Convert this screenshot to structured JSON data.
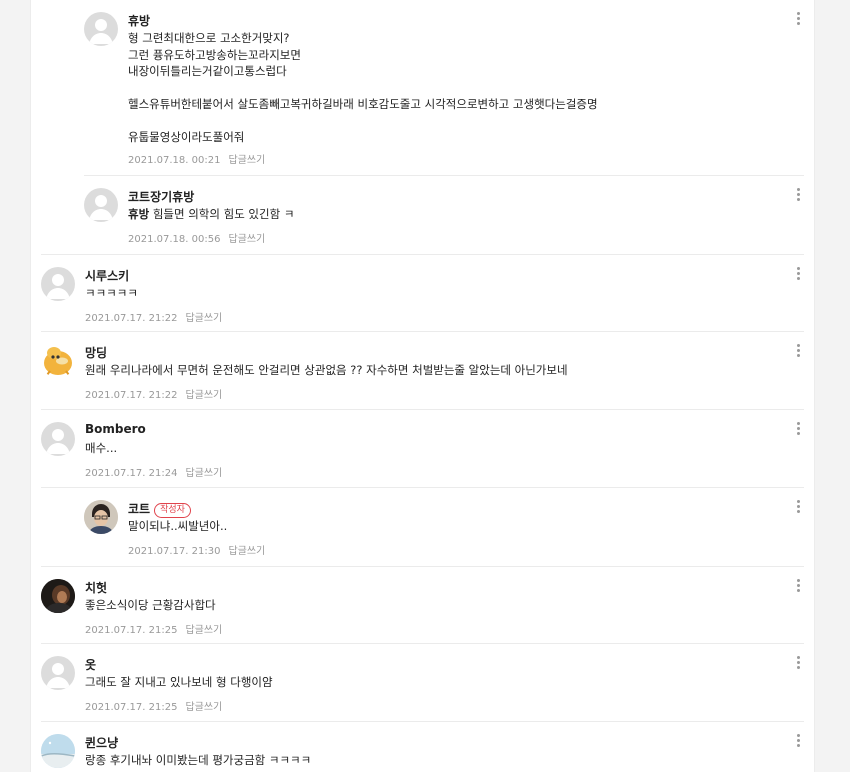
{
  "comments": [
    {
      "name": "휴방",
      "avatar": "default-avatar",
      "lines": [
        "형 그련최대한으로 고소한거맞지?",
        "그런 퓽유도하고방송하는꼬라지보면",
        "내장이뒤틀리는거같이고통스럽다",
        "",
        "헬스유튜버한테붙어서 살도좀빼고복귀하길바래 비호감도줄고 시각적으로변하고 고생햇다는걸증명",
        "",
        "유툽물영상이라도풀어줘"
      ],
      "date": "2021.07.18. 00:21",
      "reply": "답글쓰기"
    },
    {
      "name": "코트장기휴방",
      "avatar": "default-avatar",
      "mention": "휴방",
      "text": " 힘들면 의학의 힘도 있긴함 ㅋ",
      "date": "2021.07.18. 00:56",
      "reply": "답글쓰기"
    },
    {
      "name": "시루스키",
      "avatar": "default-avatar",
      "text": "ㅋㅋㅋㅋㅋ",
      "date": "2021.07.17. 21:22",
      "reply": "답글쓰기"
    },
    {
      "name": "망딩",
      "avatar": "duck-avatar",
      "text": "원래 우리나라에서 무면허 운전해도 안걸리면 상관없음 ?? 자수하면 처벌받는줄 알았는데 아닌가보네",
      "date": "2021.07.17. 21:22",
      "reply": "답글쓰기"
    },
    {
      "name": "Bombero",
      "avatar": "default-avatar",
      "text": "매수...",
      "date": "2021.07.17. 21:24",
      "reply": "답글쓰기"
    },
    {
      "name": "코트",
      "avatar": "person-photo-avatar",
      "badge": "작성자",
      "text": "말이되냐..씨발년아..",
      "date": "2021.07.17. 21:30",
      "reply": "답글쓰기"
    },
    {
      "name": "치헛",
      "avatar": "dark-photo-avatar",
      "text": "좋은소식이당 근황감사합다",
      "date": "2021.07.17. 21:25",
      "reply": "답글쓰기"
    },
    {
      "name": "옷",
      "avatar": "default-avatar",
      "text": "그래도 잘 지내고 있나보네 형 다행이얌",
      "date": "2021.07.17. 21:25",
      "reply": "답글쓰기"
    },
    {
      "name": "퀸으냥",
      "avatar": "sky-photo-avatar",
      "text": "랑종 후기내놔 이미봤는데 평가궁금함 ㅋㅋㅋㅋ",
      "date": "",
      "reply": ""
    }
  ]
}
